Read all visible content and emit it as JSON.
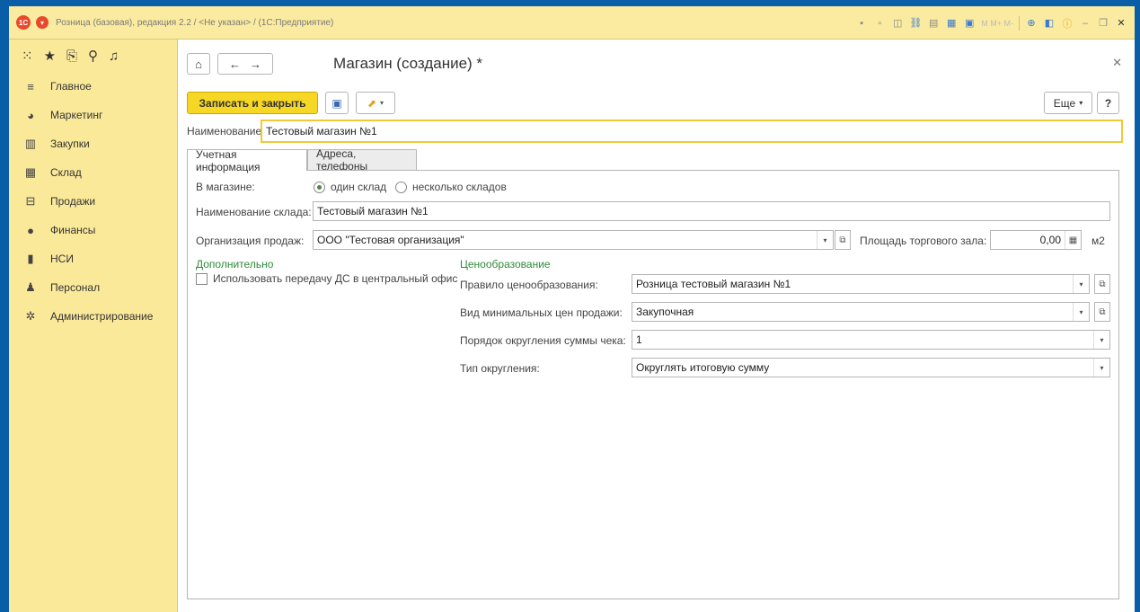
{
  "window": {
    "app_title": "Розница (базовая), редакция 2.2 / <Не указан> / (1С:Предприятие)",
    "toolbar_mtext": "M  M+  M-",
    "accent": "#f7d726",
    "frame_color": "#0a5ea8",
    "sidebar_bg": "#fbe99a"
  },
  "sidebar": {
    "items": [
      {
        "label": "Главное",
        "icon": "menu-lines-icon"
      },
      {
        "label": "Маркетинг",
        "icon": "pie-chart-icon"
      },
      {
        "label": "Закупки",
        "icon": "purchases-icon"
      },
      {
        "label": "Склад",
        "icon": "warehouse-icon"
      },
      {
        "label": "Продажи",
        "icon": "basket-icon"
      },
      {
        "label": "Финансы",
        "icon": "ruble-icon"
      },
      {
        "label": "НСИ",
        "icon": "book-icon"
      },
      {
        "label": "Персонал",
        "icon": "person-icon"
      },
      {
        "label": "Администрирование",
        "icon": "gear-icon"
      }
    ]
  },
  "form": {
    "title": "Магазин (создание) *",
    "save_close": "Записать и закрыть",
    "more": "Еще",
    "help": "?",
    "name_label": "Наименование:",
    "name_value": "Тестовый магазин №1",
    "tabs": [
      {
        "label": "Учетная информация",
        "active": true
      },
      {
        "label": "Адреса, телефоны",
        "active": false
      }
    ],
    "in_store_label": "В магазине:",
    "radio_one": "один склад",
    "radio_many": "несколько складов",
    "warehouse_label": "Наименование склада:",
    "warehouse_value": "Тестовый магазин №1",
    "org_label": "Организация продаж:",
    "org_value": "ООО \"Тестовая организация\"",
    "area_label": "Площадь торгового зала:",
    "area_value": "0,00",
    "area_unit": "м2",
    "additional_header": "Дополнительно",
    "transfer_checkbox": "Использовать передачу ДС в центральный офис",
    "pricing_header": "Ценообразование",
    "pricing_rule_label": "Правило ценообразования:",
    "pricing_rule_value": "Розница тестовый магазин №1",
    "min_price_label": "Вид минимальных цен продажи:",
    "min_price_value": "Закупочная",
    "rounding_order_label": "Порядок округления суммы чека:",
    "rounding_order_value": "1",
    "rounding_type_label": "Тип округления:",
    "rounding_type_value": "Округлять итоговую сумму"
  }
}
